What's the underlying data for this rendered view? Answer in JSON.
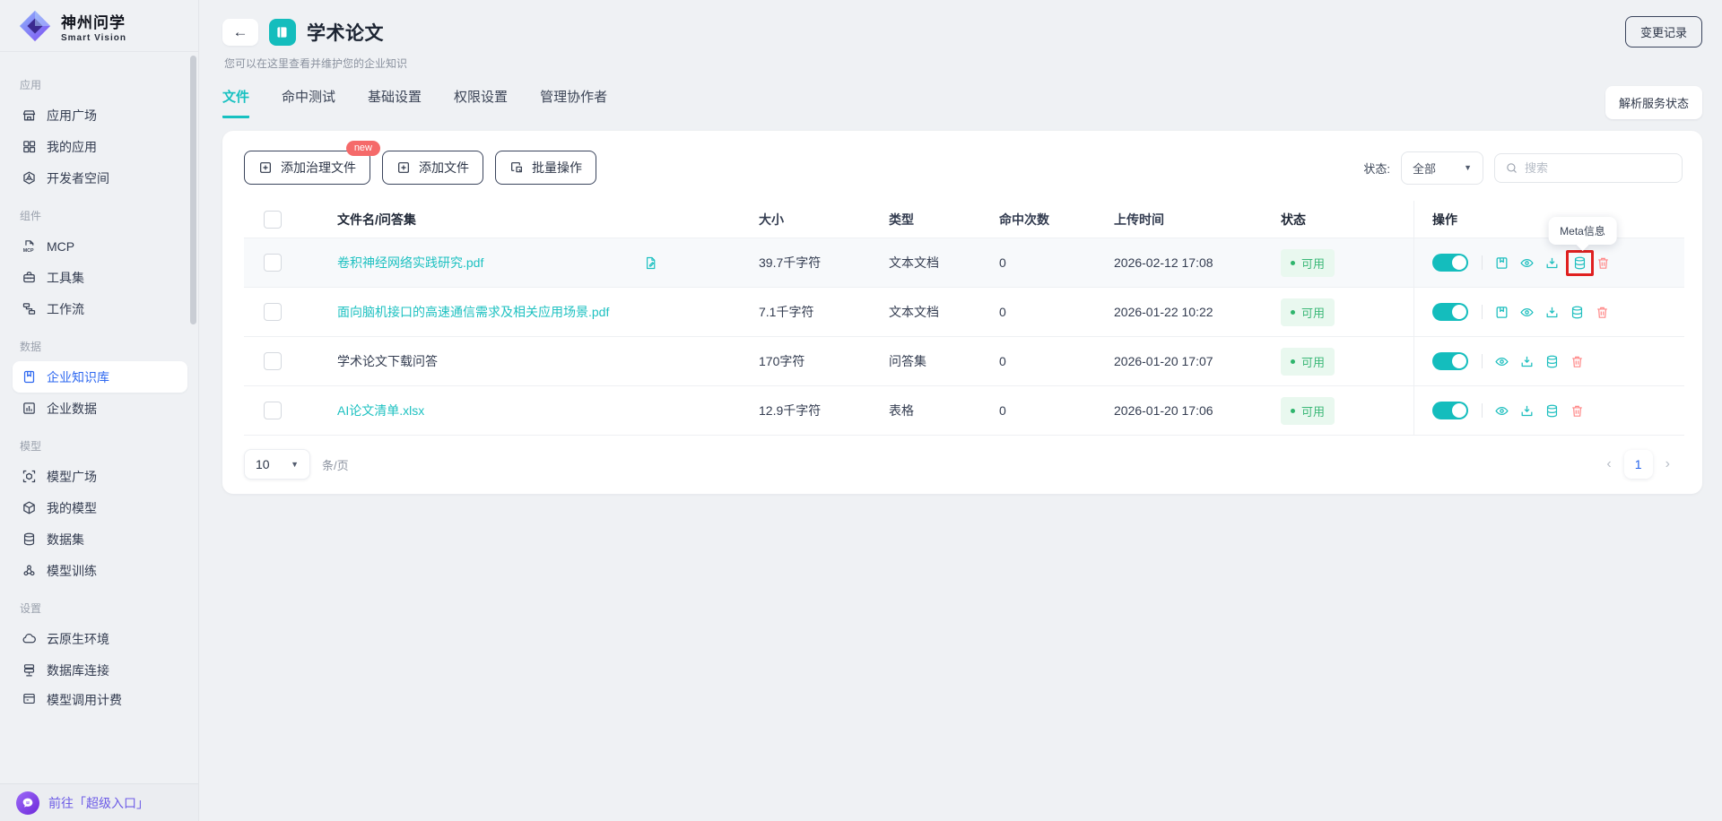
{
  "brand": {
    "name": "神州问学",
    "tagline": "Smart Vision"
  },
  "sidebar": {
    "sections": [
      {
        "label": "应用",
        "items": [
          {
            "label": "应用广场"
          },
          {
            "label": "我的应用"
          },
          {
            "label": "开发者空间"
          }
        ]
      },
      {
        "label": "组件",
        "items": [
          {
            "label": "MCP"
          },
          {
            "label": "工具集"
          },
          {
            "label": "工作流"
          }
        ]
      },
      {
        "label": "数据",
        "items": [
          {
            "label": "企业知识库"
          },
          {
            "label": "企业数据"
          }
        ]
      },
      {
        "label": "模型",
        "items": [
          {
            "label": "模型广场"
          },
          {
            "label": "我的模型"
          },
          {
            "label": "数据集"
          },
          {
            "label": "模型训练"
          }
        ]
      },
      {
        "label": "设置",
        "items": [
          {
            "label": "云原生环境"
          },
          {
            "label": "数据库连接"
          },
          {
            "label": "模型调用计费"
          }
        ]
      }
    ],
    "footer_label": "前往「超级入口」"
  },
  "header": {
    "back": "←",
    "title": "学术论文",
    "subtitle": "您可以在这里查看并维护您的企业知识",
    "change_log_button": "变更记录",
    "parse_status_button": "解析服务状态"
  },
  "tabs": [
    {
      "label": "文件"
    },
    {
      "label": "命中测试"
    },
    {
      "label": "基础设置"
    },
    {
      "label": "权限设置"
    },
    {
      "label": "管理协作者"
    }
  ],
  "toolbar": {
    "add_governance_file": "添加治理文件",
    "new_badge": "new",
    "add_file": "添加文件",
    "batch_ops": "批量操作",
    "status_label": "状态:",
    "status_value": "全部",
    "search_placeholder": "搜索"
  },
  "table": {
    "headers": [
      "文件名/问答集",
      "大小",
      "类型",
      "命中次数",
      "上传时间",
      "状态",
      "操作"
    ],
    "tooltip": "Meta信息",
    "rows": [
      {
        "name": "卷积神经网络实践研究.pdf",
        "size": "39.7千字符",
        "type": "文本文档",
        "hits": "0",
        "time": "2026-02-12 17:08",
        "status": "可用"
      },
      {
        "name": "面向脑机接口的高速通信需求及相关应用场景.pdf",
        "size": "7.1千字符",
        "type": "文本文档",
        "hits": "0",
        "time": "2026-01-22 10:22",
        "status": "可用"
      },
      {
        "name": "学术论文下载问答",
        "size": "170字符",
        "type": "问答集",
        "hits": "0",
        "time": "2026-01-20 17:07",
        "status": "可用"
      },
      {
        "name": "AI论文清单.xlsx",
        "size": "12.9千字符",
        "type": "表格",
        "hits": "0",
        "time": "2026-01-20 17:06",
        "status": "可用"
      }
    ]
  },
  "pagination": {
    "page_size": "10",
    "per_page_label": "条/页",
    "current_page": "1",
    "prev": "‹",
    "next": "›"
  },
  "colors": {
    "accent_teal": "#17c1c1",
    "active_blue": "#2e68f0",
    "status_green": "#3cb878",
    "danger_red": "#f88080",
    "new_badge_red": "#f56a6a",
    "highlight_box_red": "#e02020",
    "portal_purple": "#6d5ce6"
  }
}
